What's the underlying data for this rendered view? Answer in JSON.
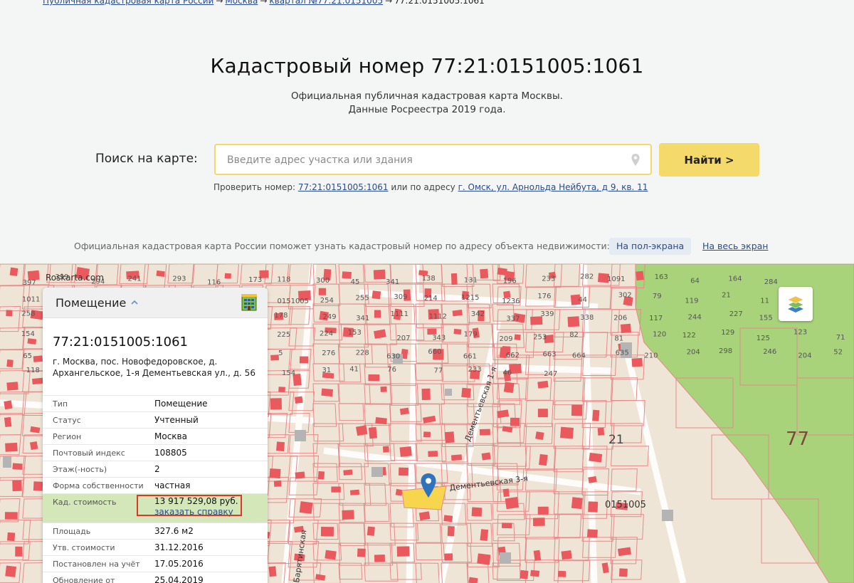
{
  "breadcrumb": {
    "items": [
      "Публичная кадастровая карта России",
      "Москва",
      "квартал №77:21:0151005"
    ],
    "current": "77:21:0151005:1061",
    "separator": "→"
  },
  "page": {
    "title": "Кадастровый номер 77:21:0151005:1061",
    "subtitle_line1": "Официальная публичная кадастровая карта Москвы.",
    "subtitle_line2": "Данные Росреестра 2019 года."
  },
  "search": {
    "label": "Поиск на карте:",
    "placeholder": "Введите адрес участка или здания",
    "button": "Найти >",
    "check_prefix": "Проверить номер:",
    "check_number": "77:21:0151005:1061",
    "check_middle": "или по адресу",
    "check_address": "г. Омск, ул. Арнольда Нейбута, д 9, кв. 11"
  },
  "map_controls": {
    "info": "Официальная кадастровая карта России поможет узнать кадастровый номер по адресу объекта недвижимости:",
    "half_screen": "На пол-экрана",
    "full_screen": "На весь экран"
  },
  "map": {
    "watermark": "Roskarta.com",
    "region_number": "77",
    "quarter_label": "0151005",
    "area_label": "21",
    "streets": [
      "Дементьевская 3-я",
      "Дементьевская 1-я",
      "Барятинская"
    ],
    "parcel_labels": [
      "397",
      "399",
      "294",
      "241",
      "293",
      "116",
      "173",
      "118",
      "300",
      "45",
      "341",
      "138",
      "131",
      "196",
      "233",
      "282",
      "1091",
      "163",
      "64",
      "164",
      "284",
      "1011",
      "0151005",
      "254",
      "255",
      "309",
      "214",
      "1215",
      "1236",
      "176",
      "44",
      "302",
      "79",
      "119",
      "21",
      "11",
      "258",
      "178",
      "249",
      "341",
      "1111",
      "1112",
      "342",
      "337",
      "339",
      "338",
      "206",
      "117",
      "244",
      "227",
      "155",
      "154",
      "225",
      "224",
      "153",
      "207",
      "343",
      "179",
      "209",
      "253",
      "82",
      "81",
      "120",
      "122",
      "129",
      "125",
      "123",
      "71",
      "65",
      "5",
      "276",
      "228",
      "630",
      "660",
      "661",
      "662",
      "663",
      "664",
      "635",
      "210",
      "204",
      "298",
      "246",
      "204",
      "52",
      "118",
      "154",
      "31",
      "41",
      "76",
      "77",
      "233",
      "46",
      "247"
    ],
    "colors": {
      "background": "#efe5d6",
      "parcel_border": "#e58a8a",
      "building": "#e9595e",
      "green_area": "#a8d37a",
      "selected_parcel": "#f7d54c",
      "marker": "#2f73bf"
    }
  },
  "panel": {
    "type_title": "Помещение",
    "cad_number": "77:21:0151005:1061",
    "address": "г. Москва, пос. Новофедоровское, д. Архангельское, 1-я Дементьевская ул., д. 56",
    "rows": [
      {
        "k": "Тип",
        "v": "Помещение"
      },
      {
        "k": "Статус",
        "v": "Учтенный"
      },
      {
        "k": "Регион",
        "v": "Москва"
      },
      {
        "k": "Почтовый индекс",
        "v": "108805"
      },
      {
        "k": "Этаж(-ность)",
        "v": "2"
      },
      {
        "k": "Форма собственности",
        "v": "частная"
      },
      {
        "k": "Кад. стоимость",
        "v": "13 917 529,08 руб.",
        "link": "заказать справку"
      },
      {
        "k": "Площадь",
        "v": "327.6 м2"
      },
      {
        "k": "Утв. стоимости",
        "v": "31.12.2016"
      },
      {
        "k": "Постановлен на учёт",
        "v": "17.05.2016"
      },
      {
        "k": "Обновление от",
        "v": "25.04.2019"
      }
    ]
  }
}
